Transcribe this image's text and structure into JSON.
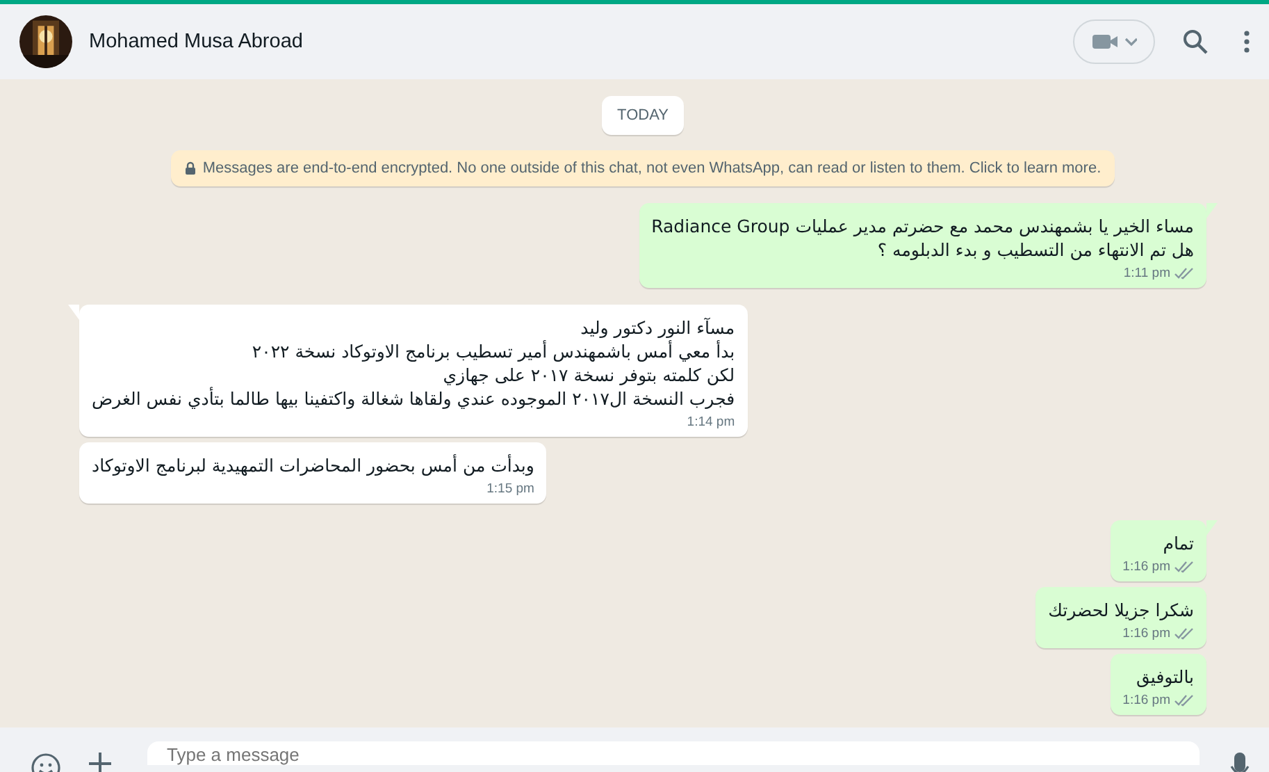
{
  "header": {
    "contact_name": "Mohamed Musa Abroad"
  },
  "date_chip": "TODAY",
  "encryption_notice": "Messages are end-to-end encrypted. No one outside of this chat, not even WhatsApp, can read or listen to them. Click to learn more.",
  "messages": [
    {
      "outgoing": true,
      "text": "مساء الخير يا بشمهندس محمد مع حضرتم مدير عمليات Radiance Group\nهل تم الانتهاء من التسطيب و بدء الدبلومه ؟",
      "time": "1:11 pm",
      "read": false,
      "tail": true
    },
    {
      "outgoing": false,
      "text": "مسآء النور دكتور وليد\nبدأ معي أمس باشمهندس أمير تسطيب برنامج الاوتوكاد نسخة ٢٠٢٢\nلكن كلمته بتوفر نسخة ٢٠١٧ على جهازي\nفجرب النسخة ال٢٠١٧ الموجوده عندي ولقاها شغالة واكتفينا بيها طالما بتأدي نفس الغرض",
      "time": "1:14 pm",
      "tail": true
    },
    {
      "outgoing": false,
      "text": "وبدأت من أمس بحضور المحاضرات التمهيدية لبرنامج الاوتوكاد",
      "time": "1:15 pm",
      "tail": false
    },
    {
      "outgoing": true,
      "text": "تمام",
      "time": "1:16 pm",
      "read": false,
      "tail": true
    },
    {
      "outgoing": true,
      "text": "شكرا جزيلا لحضرتك",
      "time": "1:16 pm",
      "read": false,
      "tail": false
    },
    {
      "outgoing": true,
      "text": "بالتوفيق",
      "time": "1:16 pm",
      "read": false,
      "tail": false
    }
  ],
  "composer": {
    "placeholder": "Type a message"
  }
}
